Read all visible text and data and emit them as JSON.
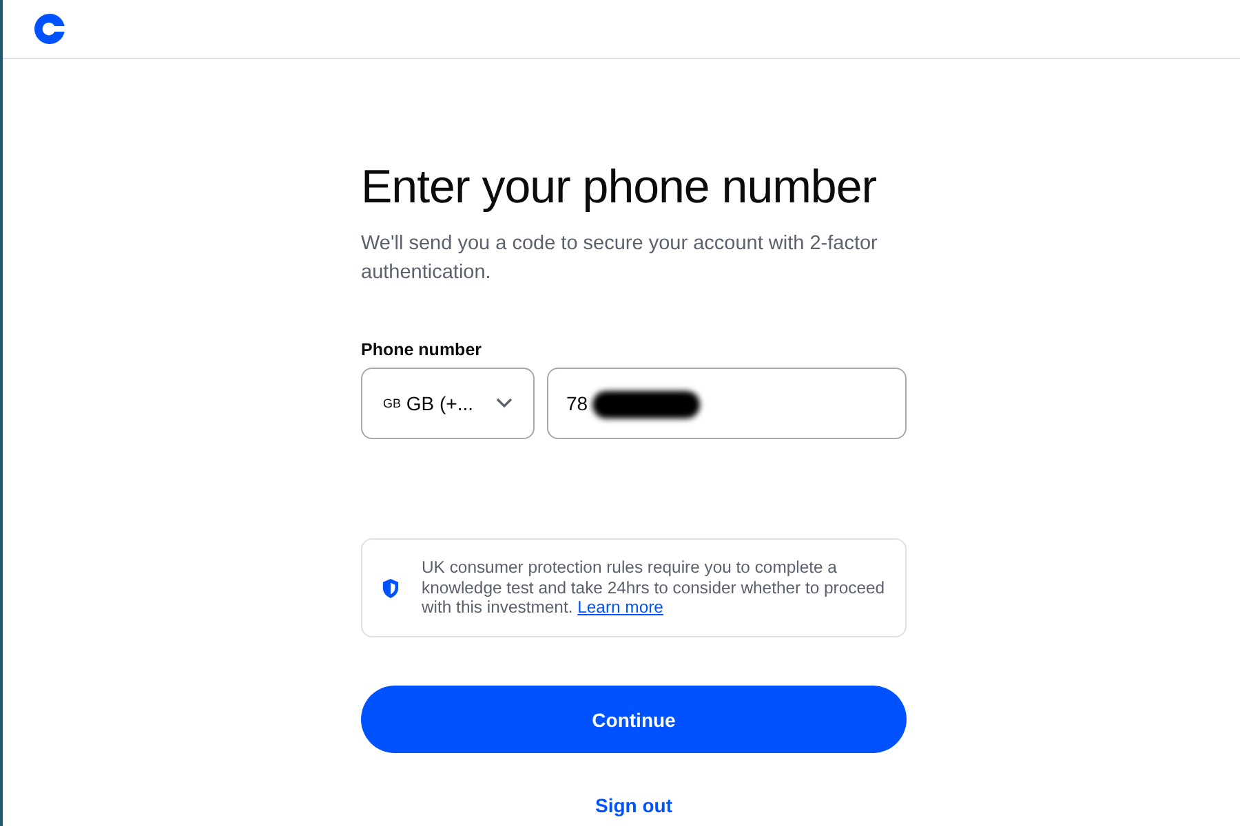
{
  "title": "Enter your phone number",
  "subtitle": "We'll send you a code to secure your account with 2-factor authentication.",
  "phone": {
    "label": "Phone number",
    "country_code": "GB",
    "country": "GB (+...",
    "value": "78",
    "redacted": true
  },
  "notice": {
    "text": "UK consumer protection rules require you to complete a knowledge test and take 24hrs to consider whether to proceed with this investment.",
    "link": "Learn more"
  },
  "primary_button": "Continue",
  "secondary_link": "Sign out"
}
